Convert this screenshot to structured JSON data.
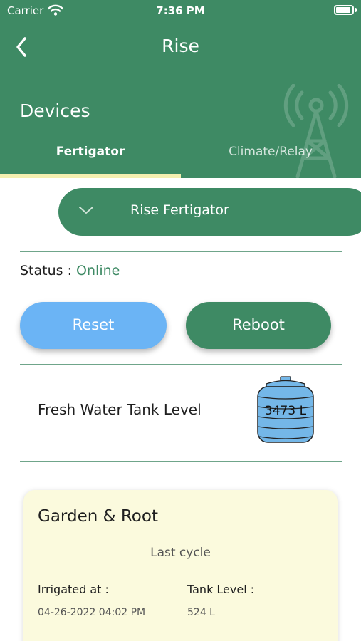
{
  "status_bar": {
    "carrier": "Carrier",
    "time": "7:36 PM"
  },
  "header": {
    "title": "Rise",
    "section_title": "Devices"
  },
  "tabs": [
    {
      "label": "Fertigator",
      "active": true
    },
    {
      "label": "Climate/Relay",
      "active": false
    }
  ],
  "device_selector": {
    "value": "Rise Fertigator"
  },
  "status": {
    "label": "Status :",
    "value": "Online"
  },
  "buttons": {
    "reset": "Reset",
    "reboot": "Reboot"
  },
  "tank": {
    "label": "Fresh Water Tank Level",
    "value": "3473 L"
  },
  "card": {
    "title": "Garden & Root",
    "subtitle": "Last cycle",
    "irrigated_label": "Irrigated at :",
    "irrigated_value": "04-26-2022 04:02 PM",
    "tank_label": "Tank Level :",
    "tank_value": "524 L"
  },
  "colors": {
    "primary": "#3e8a64",
    "reset": "#6bb4f5",
    "tab_indicator": "#f4efb0",
    "card_bg": "#fbfadd"
  },
  "icons": [
    "wifi-icon",
    "battery-icon",
    "back-chevron-icon",
    "antenna-tower-icon",
    "chevron-down-icon",
    "water-tank-icon"
  ]
}
